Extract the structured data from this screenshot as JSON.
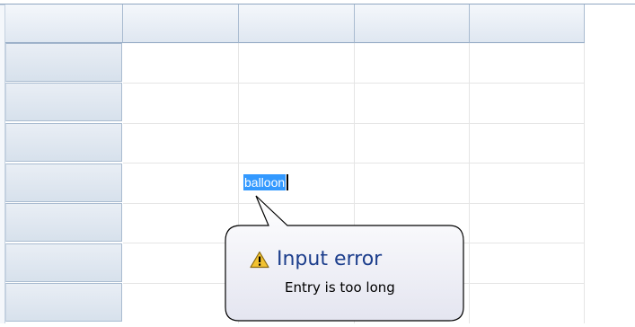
{
  "grid": {
    "column_headers": [
      "",
      "",
      "",
      "",
      ""
    ],
    "row_headers": [
      "",
      "",
      "",
      "",
      "",
      "",
      ""
    ]
  },
  "editing_cell": {
    "value": "balloon"
  },
  "tooltip": {
    "icon": "warning-icon",
    "title": "Input error",
    "message": "Entry is too long",
    "colors": {
      "title": "#1c3e8c",
      "border": "#000000",
      "background_top": "#ffffff",
      "background_bottom": "#e4e5f0",
      "warning": "#f2c230"
    }
  }
}
